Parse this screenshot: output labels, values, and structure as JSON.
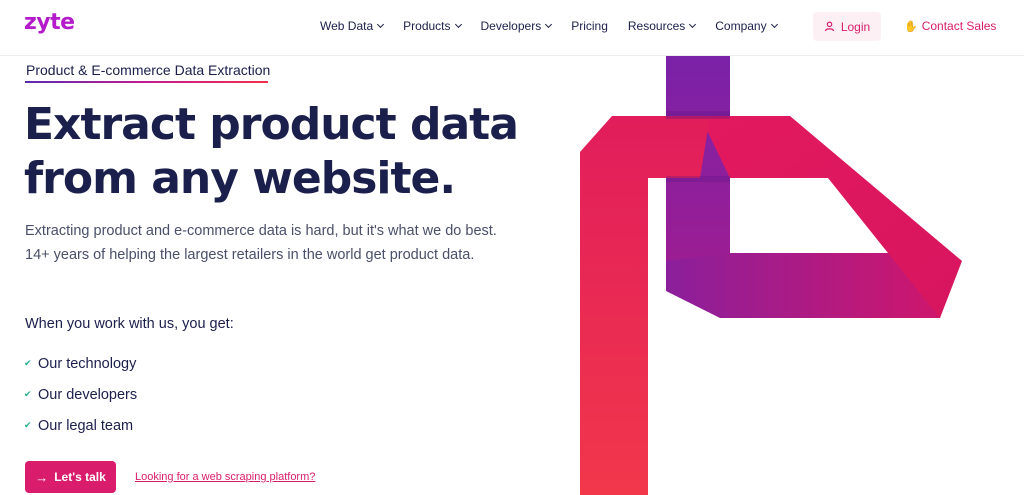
{
  "brand": {
    "logo_text": "zyte"
  },
  "nav": {
    "items": [
      {
        "label": "Web Data",
        "has_dropdown": true
      },
      {
        "label": "Products",
        "has_dropdown": true
      },
      {
        "label": "Developers",
        "has_dropdown": true
      },
      {
        "label": "Pricing",
        "has_dropdown": false
      },
      {
        "label": "Resources",
        "has_dropdown": true
      },
      {
        "label": "Company",
        "has_dropdown": true
      }
    ],
    "login_label": "Login",
    "contact_label": "Contact Sales"
  },
  "hero": {
    "eyebrow": "Product & E-commerce Data Extraction",
    "title_line1": "Extract product data",
    "title_line2": "from any website.",
    "subtitle": "Extracting product and e-commerce data is hard, but it's what we do best. 14+ years of helping the largest retailers in the world get product data.",
    "benefits_heading": "When you work with us, you get:",
    "benefits": [
      "Our technology",
      "Our developers",
      "Our legal team"
    ],
    "cta_label": "Let's talk",
    "secondary_link": "Looking for a web scraping platform?"
  },
  "colors": {
    "brand": "#b41ccb",
    "accent": "#d91d6c",
    "heading": "#1b1f4b",
    "check": "#1fae8a"
  },
  "icons": {
    "login": "user-icon",
    "contact": "waving-hand-icon",
    "check": "check-icon",
    "cta": "arrow-right-icon"
  }
}
